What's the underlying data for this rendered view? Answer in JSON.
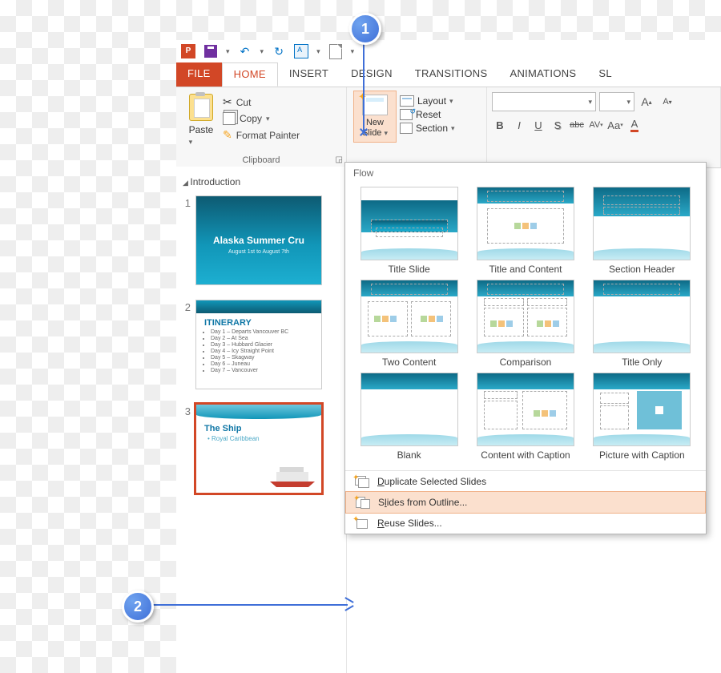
{
  "qat": {
    "save": "Save",
    "undo": "↶",
    "redo": "↻"
  },
  "tabs": {
    "file": "FILE",
    "home": "HOME",
    "insert": "INSERT",
    "design": "DESIGN",
    "transitions": "TRANSITIONS",
    "animations": "ANIMATIONS",
    "slideshow": "SL"
  },
  "clipboard": {
    "label": "Clipboard",
    "paste": "Paste",
    "cut": "Cut",
    "copy": "Copy",
    "format_painter": "Format Painter"
  },
  "slides_group": {
    "new_slide": "New Slide",
    "layout": "Layout",
    "reset": "Reset",
    "section": "Section"
  },
  "font_group": {
    "bold": "B",
    "italic": "I",
    "underline": "U",
    "shadow": "S",
    "strike": "abc",
    "spacing": "AV",
    "case": "Aa",
    "clear": "A",
    "grow": "A",
    "shrink": "A"
  },
  "panel": {
    "section": "Introduction",
    "s1_num": "1",
    "s1_title": "Alaska Summer Cru",
    "s1_sub": "August 1st to August 7th",
    "s2_num": "2",
    "s2_title": "ITINERARY",
    "s2_items": [
      "Day 1 – Departs Vancouver BC",
      "Day 2 – At Sea",
      "Day 3 – Hubbard Glacier",
      "Day 4 – Icy Straight Point",
      "Day 5 – Skagway",
      "Day 6 – Juneau",
      "Day 7 – Vancouver"
    ],
    "s3_num": "3",
    "s3_title": "The Ship",
    "s3_sub": "• Royal Caribbean"
  },
  "dropdown": {
    "header": "Flow",
    "layouts": [
      "Title Slide",
      "Title and Content",
      "Section Header",
      "Two Content",
      "Comparison",
      "Title Only",
      "Blank",
      "Content with Caption",
      "Picture with Caption"
    ],
    "duplicate": "Duplicate Selected Slides",
    "outline": "Slides from Outline...",
    "reuse": "Reuse Slides..."
  },
  "callouts": {
    "one": "1",
    "two": "2"
  }
}
